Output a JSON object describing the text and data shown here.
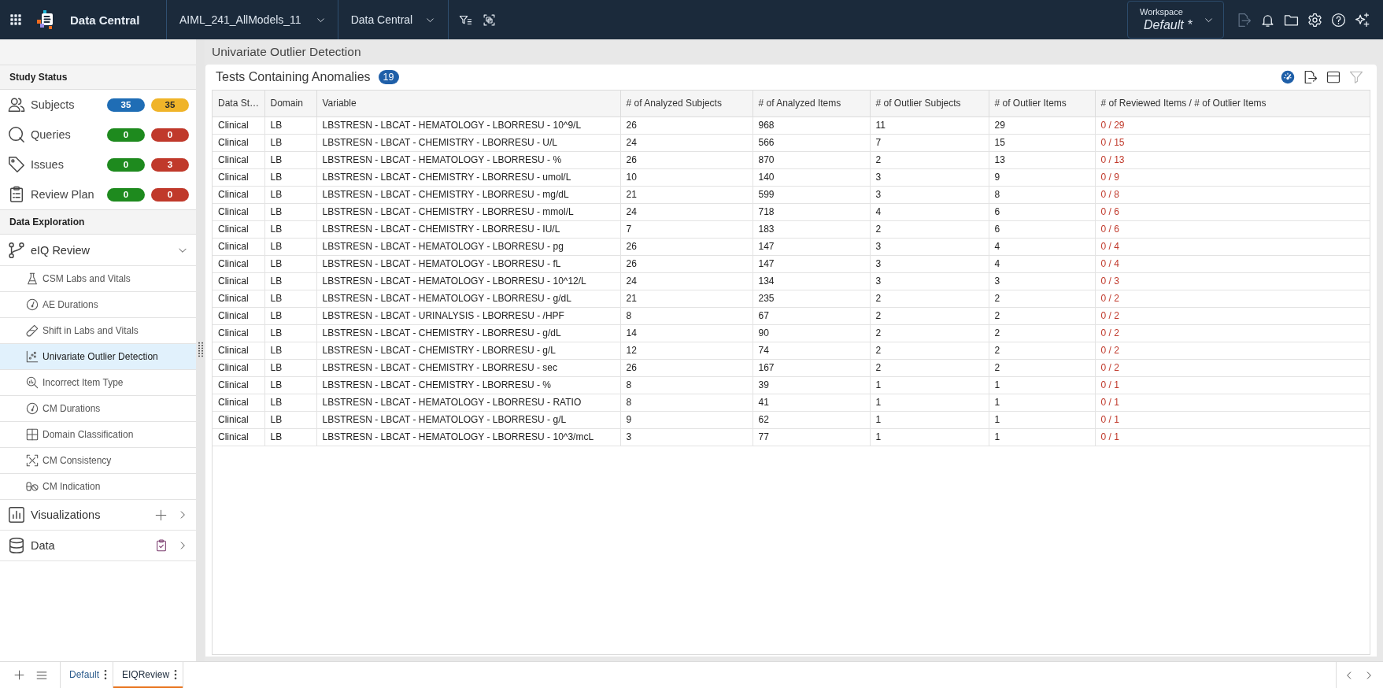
{
  "top_bar": {
    "app_name": "Data Central",
    "study": "AIML_241_AllModels_11",
    "module": "Data Central",
    "workspace": {
      "label": "Workspace",
      "name": "Default *"
    },
    "actions": [
      {
        "disabled": true
      },
      {
        "disabled": false
      },
      {
        "disabled": false
      },
      {
        "disabled": false
      },
      {
        "disabled": false
      },
      {
        "disabled": false
      }
    ]
  },
  "sidebar": {
    "study_status": {
      "heading": "Study Status",
      "items": [
        {
          "label": "Subjects",
          "counts": [
            {
              "value": "35",
              "color": "#1f6db5"
            },
            {
              "value": "35",
              "color": "#f0b429"
            }
          ]
        },
        {
          "label": "Queries",
          "counts": [
            {
              "value": "0",
              "color": "#1e8a1e"
            },
            {
              "value": "0",
              "color": "#c0392b"
            }
          ]
        },
        {
          "label": "Issues",
          "counts": [
            {
              "value": "0",
              "color": "#1e8a1e"
            },
            {
              "value": "3",
              "color": "#c0392b"
            }
          ]
        },
        {
          "label": "Review Plan",
          "counts": [
            {
              "value": "0",
              "color": "#1e8a1e"
            },
            {
              "value": "0",
              "color": "#c0392b"
            }
          ]
        }
      ]
    },
    "data_exploration": {
      "heading": "Data Exploration",
      "groups": [
        {
          "label": "eIQ Review",
          "expanded": true,
          "children": [
            {
              "label": "CSM Labs and Vitals",
              "selected": false
            },
            {
              "label": "AE Durations",
              "selected": false
            },
            {
              "label": "Shift in Labs and Vitals",
              "selected": false
            },
            {
              "label": "Univariate Outlier Detection",
              "selected": true
            },
            {
              "label": "Incorrect Item Type",
              "selected": false
            },
            {
              "label": "CM Durations",
              "selected": false
            },
            {
              "label": "Domain Classification",
              "selected": false
            },
            {
              "label": "CM Consistency",
              "selected": false
            },
            {
              "label": "CM Indication",
              "selected": false
            }
          ]
        },
        {
          "label": "Visualizations",
          "expanded": false
        },
        {
          "label": "Data",
          "expanded": false
        }
      ]
    }
  },
  "page_title": "Univariate Outlier Detection",
  "panel": {
    "title": "Tests Containing Anomalies",
    "count": "19",
    "tools": [
      {
        "disabled": false
      },
      {
        "disabled": false
      },
      {
        "disabled": false
      },
      {
        "disabled": true
      }
    ],
    "table": {
      "columns": [
        "Data St…",
        "Domain",
        "Variable",
        "# of Analyzed Subjects",
        "# of Analyzed Items",
        "# of Outlier Subjects",
        "# of Outlier Items",
        "# of Reviewed Items / # of Outlier Items"
      ],
      "rows": [
        [
          "Clinical",
          "LB",
          "LBSTRESN - LBCAT - HEMATOLOGY - LBORRESU - 10^9/L",
          "26",
          "968",
          "11",
          "29",
          "0 / 29"
        ],
        [
          "Clinical",
          "LB",
          "LBSTRESN - LBCAT - CHEMISTRY - LBORRESU - U/L",
          "24",
          "566",
          "7",
          "15",
          "0 / 15"
        ],
        [
          "Clinical",
          "LB",
          "LBSTRESN - LBCAT - HEMATOLOGY - LBORRESU - %",
          "26",
          "870",
          "2",
          "13",
          "0 / 13"
        ],
        [
          "Clinical",
          "LB",
          "LBSTRESN - LBCAT - CHEMISTRY - LBORRESU - umol/L",
          "10",
          "140",
          "3",
          "9",
          "0 / 9"
        ],
        [
          "Clinical",
          "LB",
          "LBSTRESN - LBCAT - CHEMISTRY - LBORRESU - mg/dL",
          "21",
          "599",
          "3",
          "8",
          "0 / 8"
        ],
        [
          "Clinical",
          "LB",
          "LBSTRESN - LBCAT - CHEMISTRY - LBORRESU - mmol/L",
          "24",
          "718",
          "4",
          "6",
          "0 / 6"
        ],
        [
          "Clinical",
          "LB",
          "LBSTRESN - LBCAT - CHEMISTRY - LBORRESU - IU/L",
          "7",
          "183",
          "2",
          "6",
          "0 / 6"
        ],
        [
          "Clinical",
          "LB",
          "LBSTRESN - LBCAT - HEMATOLOGY - LBORRESU - pg",
          "26",
          "147",
          "3",
          "4",
          "0 / 4"
        ],
        [
          "Clinical",
          "LB",
          "LBSTRESN - LBCAT - HEMATOLOGY - LBORRESU - fL",
          "26",
          "147",
          "3",
          "4",
          "0 / 4"
        ],
        [
          "Clinical",
          "LB",
          "LBSTRESN - LBCAT - HEMATOLOGY - LBORRESU - 10^12/L",
          "24",
          "134",
          "3",
          "3",
          "0 / 3"
        ],
        [
          "Clinical",
          "LB",
          "LBSTRESN - LBCAT - HEMATOLOGY - LBORRESU - g/dL",
          "21",
          "235",
          "2",
          "2",
          "0 / 2"
        ],
        [
          "Clinical",
          "LB",
          "LBSTRESN - LBCAT - URINALYSIS - LBORRESU - /HPF",
          "8",
          "67",
          "2",
          "2",
          "0 / 2"
        ],
        [
          "Clinical",
          "LB",
          "LBSTRESN - LBCAT - CHEMISTRY - LBORRESU - g/dL",
          "14",
          "90",
          "2",
          "2",
          "0 / 2"
        ],
        [
          "Clinical",
          "LB",
          "LBSTRESN - LBCAT - CHEMISTRY - LBORRESU - g/L",
          "12",
          "74",
          "2",
          "2",
          "0 / 2"
        ],
        [
          "Clinical",
          "LB",
          "LBSTRESN - LBCAT - CHEMISTRY - LBORRESU - sec",
          "26",
          "167",
          "2",
          "2",
          "0 / 2"
        ],
        [
          "Clinical",
          "LB",
          "LBSTRESN - LBCAT - CHEMISTRY - LBORRESU - %",
          "8",
          "39",
          "1",
          "1",
          "0 / 1"
        ],
        [
          "Clinical",
          "LB",
          "LBSTRESN - LBCAT - HEMATOLOGY - LBORRESU - RATIO",
          "8",
          "41",
          "1",
          "1",
          "0 / 1"
        ],
        [
          "Clinical",
          "LB",
          "LBSTRESN - LBCAT - HEMATOLOGY - LBORRESU - g/L",
          "9",
          "62",
          "1",
          "1",
          "0 / 1"
        ],
        [
          "Clinical",
          "LB",
          "LBSTRESN - LBCAT - HEMATOLOGY - LBORRESU - 10^3/mcL",
          "3",
          "77",
          "1",
          "1",
          "0 / 1"
        ]
      ]
    }
  },
  "bottom_bar": {
    "tabs": [
      {
        "label": "Default",
        "selected": false
      },
      {
        "label": "EIQReview",
        "selected": true
      }
    ]
  }
}
